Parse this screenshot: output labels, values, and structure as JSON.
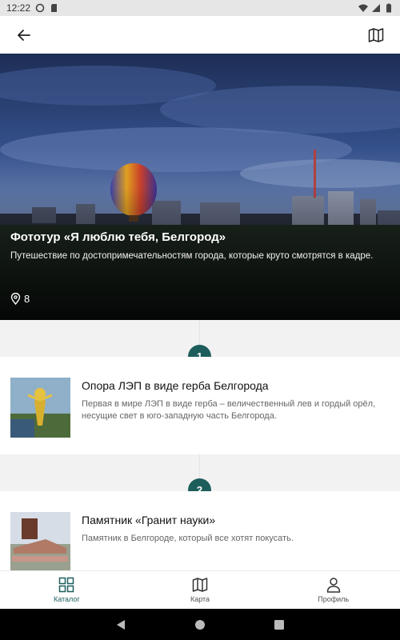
{
  "status_bar": {
    "time": "12:22",
    "icons": [
      "sync-icon",
      "sd-card-icon",
      "wifi-icon",
      "signal-icon",
      "battery-icon"
    ]
  },
  "app_bar": {
    "back_icon": "arrow-left-icon",
    "map_icon": "map-icon"
  },
  "tour": {
    "title": "Фототур «Я люблю тебя, Белгород»",
    "description": "Путешествие по достопримечательностям города, которые круто смотрятся в кадре.",
    "stops_count": "8",
    "count_icon": "location-pin-icon"
  },
  "stops": [
    {
      "number": "1",
      "title": "Опора ЛЭП в виде герба Белгорода",
      "description": "Первая в мире ЛЭП в виде герба – величественный лев и гордый орёл, несущие свет в юго-западную часть Белгорода."
    },
    {
      "number": "2",
      "title": "Памятник «Гранит науки»",
      "description": "Памятник в Белгороде, который все хотят покусать."
    }
  ],
  "bottom_nav": {
    "items": [
      {
        "label": "Каталог",
        "icon": "grid-icon",
        "active": true
      },
      {
        "label": "Карта",
        "icon": "map-icon",
        "active": false
      },
      {
        "label": "Профиль",
        "icon": "person-icon",
        "active": false
      }
    ]
  },
  "colors": {
    "accent": "#1d5e5c",
    "background": "#f2f2f2"
  }
}
